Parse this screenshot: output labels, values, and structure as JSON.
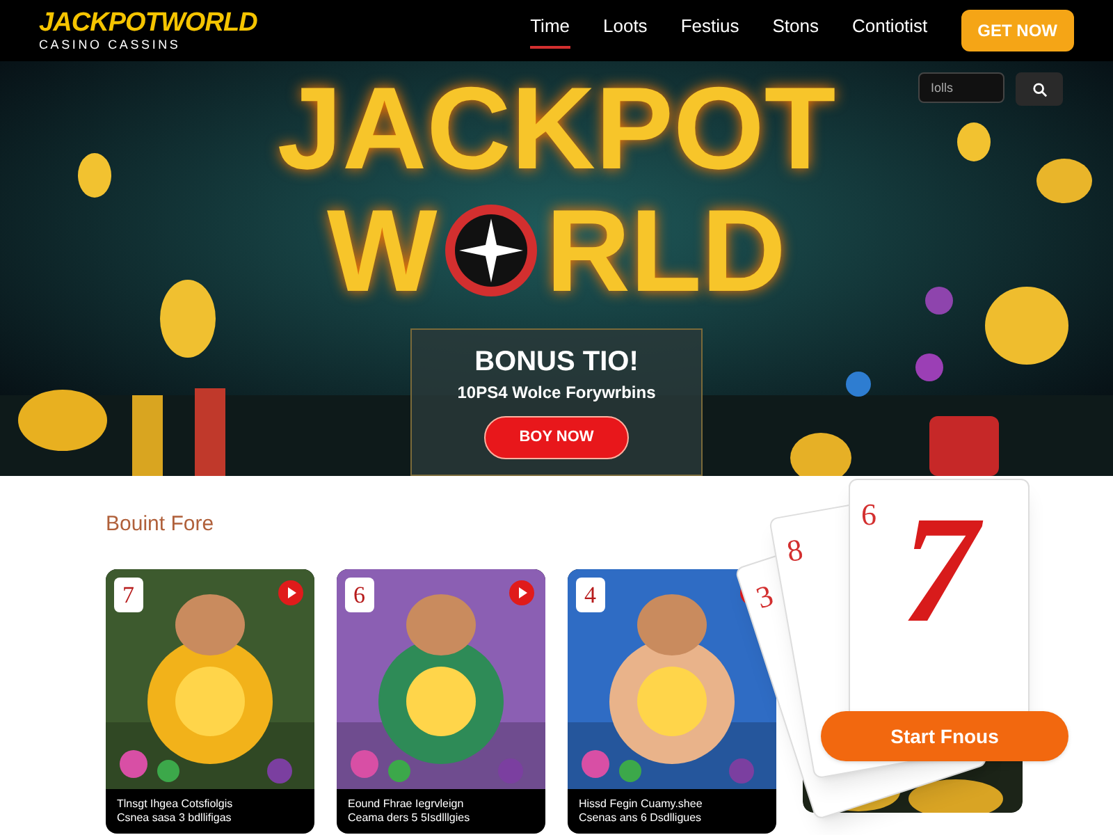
{
  "header": {
    "logo": "JACKPOTWORLD",
    "tagline": "CASINO CASSINS",
    "nav": [
      {
        "label": "Time",
        "selected": true
      },
      {
        "label": "Loots",
        "selected": false
      },
      {
        "label": "Festius",
        "selected": false
      },
      {
        "label": "Stons",
        "selected": false
      },
      {
        "label": "Contiotist",
        "selected": false
      }
    ],
    "cta": "GET NOW"
  },
  "hero": {
    "title_line_1": "JACKPOT",
    "title_line_2": "W",
    "title_line_2_rest": "RLD",
    "search": {
      "placeholder": "Iolls"
    },
    "banner": {
      "title": "BONUS TIO!",
      "subtitle": "10PS4 Wolce Forywrbins",
      "button": "BOY NOW"
    }
  },
  "section": {
    "title": "Bouint Fore",
    "cards": [
      {
        "rank": "7",
        "caption_1": "Tlnsgt Ihgea Cotsfiolgis",
        "caption_2": "Csnea sasa 3 bdllifigas",
        "kind": "wheel"
      },
      {
        "rank": "6",
        "caption_1": "Eound Fhrae Iegrvleign",
        "caption_2": "Ceama ders 5 5Isdlllgies",
        "kind": "elf"
      },
      {
        "rank": "4",
        "caption_1": "Hissd Fegin Cuamy.shee",
        "caption_2": "Csenas ans 6 Dsdlligues",
        "kind": "hero"
      }
    ],
    "playing_cards": [
      {
        "rank": "3"
      },
      {
        "rank": "8"
      },
      {
        "rank": "6"
      }
    ],
    "big_seven": "7",
    "start_button": "Start Fnous"
  }
}
